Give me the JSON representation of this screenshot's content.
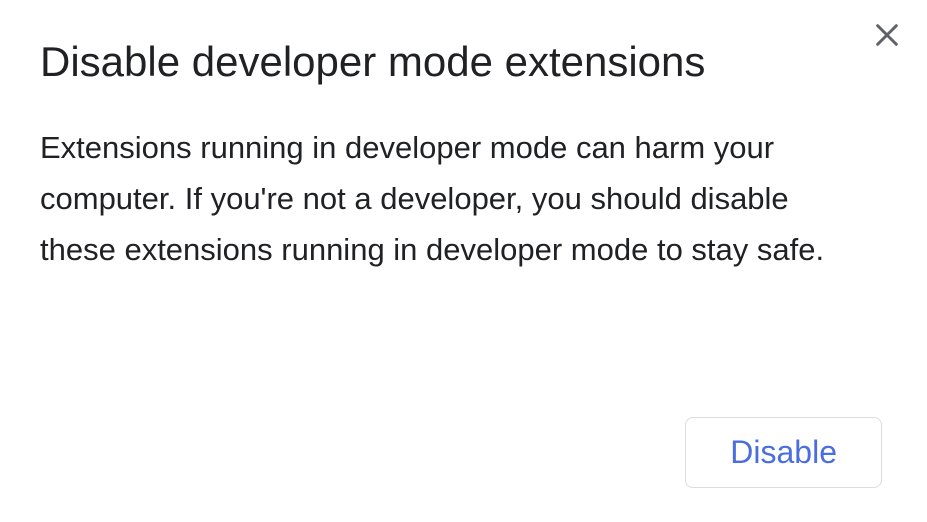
{
  "dialog": {
    "title": "Disable developer mode extensions",
    "body": "Extensions running in developer mode can harm your computer. If you're not a developer, you should disable these extensions running in developer mode to stay safe.",
    "disable_label": "Disable"
  }
}
